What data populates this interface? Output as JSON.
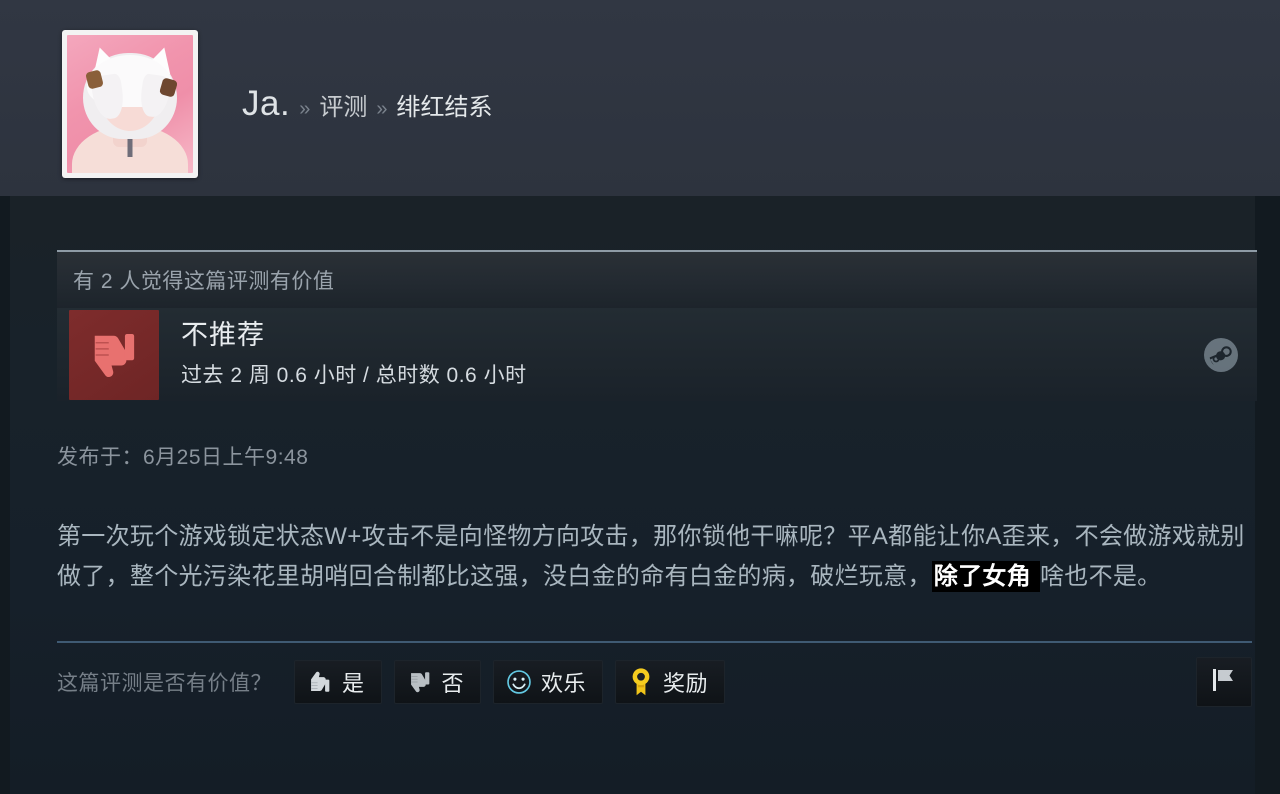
{
  "header": {
    "avatar_alt": "user-avatar-anime-girl",
    "breadcrumb": {
      "user": "Ja.",
      "sep1": "»",
      "section": "评测",
      "sep2": "»",
      "game": "绯红结系"
    }
  },
  "review": {
    "helpfulness": "有 2 人觉得这篇评测有价值",
    "verdict": "不推荐",
    "playtime": "过去 2 周 0.6 小时 / 总时数 0.6 小时",
    "posted": "发布于：6月25日上午9:48",
    "body_part1": "第一次玩个游戏锁定状态W+攻击不是向怪物方向攻击，那你锁他干嘛呢？平A都能让你A歪来，不会做游戏就别做了，整个光污染花里胡哨回合制都比这强，没白金的命有白金的病，破烂玩意，",
    "body_highlight": "除了女角 ",
    "body_part2": "啥也不是。",
    "icons": {
      "verdict_icon": "thumbs-down-icon",
      "platform_icon": "steam-logo-icon"
    }
  },
  "footer": {
    "question": "这篇评测是否有价值？",
    "buttons": [
      {
        "label": "是",
        "icon": "thumbs-up-icon"
      },
      {
        "label": "否",
        "icon": "thumbs-down-icon"
      },
      {
        "label": "欢乐",
        "icon": "smiley-face-icon"
      },
      {
        "label": "奖励",
        "icon": "award-medal-icon"
      }
    ],
    "report_icon": "flag-icon"
  },
  "colors": {
    "header_bg": "#2f3541",
    "page_bg": "#121a20",
    "content_bg": "#1a2228",
    "negative_red": "#7d2b2b",
    "thumb_red": "#e86a6a",
    "accent_blue": "#3f5a73",
    "smiley_cyan": "#5fd0e8",
    "award_gold": "#f0c419",
    "highlight_bg": "#000000"
  }
}
